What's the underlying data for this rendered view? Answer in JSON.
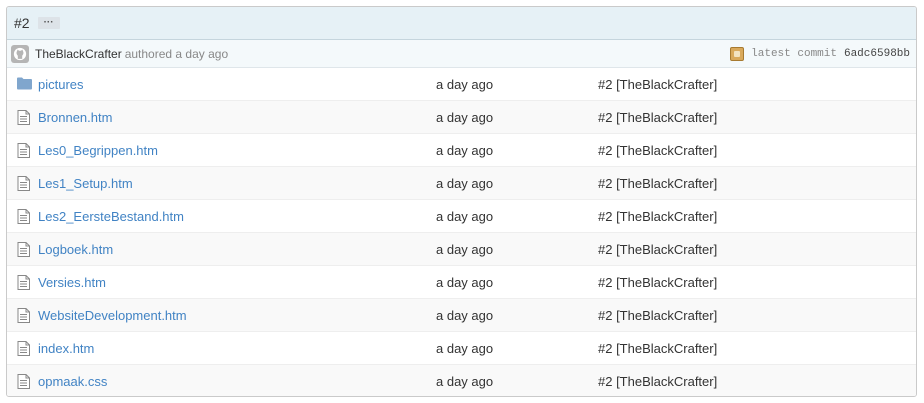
{
  "commit": {
    "message": "#2",
    "ellipsis": "···",
    "author": "TheBlackCrafter",
    "authored": "authored a day ago",
    "latest_label": "latest commit",
    "sha": "6adc6598bb"
  },
  "files": [
    {
      "name": "pictures",
      "type": "folder",
      "age": "a day ago",
      "message": "#2 [TheBlackCrafter]"
    },
    {
      "name": "Bronnen.htm",
      "type": "file",
      "age": "a day ago",
      "message": "#2 [TheBlackCrafter]"
    },
    {
      "name": "Les0_Begrippen.htm",
      "type": "file",
      "age": "a day ago",
      "message": "#2 [TheBlackCrafter]"
    },
    {
      "name": "Les1_Setup.htm",
      "type": "file",
      "age": "a day ago",
      "message": "#2 [TheBlackCrafter]"
    },
    {
      "name": "Les2_EersteBestand.htm",
      "type": "file",
      "age": "a day ago",
      "message": "#2 [TheBlackCrafter]"
    },
    {
      "name": "Logboek.htm",
      "type": "file",
      "age": "a day ago",
      "message": "#2 [TheBlackCrafter]"
    },
    {
      "name": "Versies.htm",
      "type": "file",
      "age": "a day ago",
      "message": "#2 [TheBlackCrafter]"
    },
    {
      "name": "WebsiteDevelopment.htm",
      "type": "file",
      "age": "a day ago",
      "message": "#2 [TheBlackCrafter]"
    },
    {
      "name": "index.htm",
      "type": "file",
      "age": "a day ago",
      "message": "#2 [TheBlackCrafter]"
    },
    {
      "name": "opmaak.css",
      "type": "file",
      "age": "a day ago",
      "message": "#2 [TheBlackCrafter]"
    }
  ],
  "colors": {
    "link": "#4183c4",
    "header_bg": "#e6f1f6",
    "meta_bg": "#f4f9fb",
    "folder_icon": "#80a6cd"
  }
}
